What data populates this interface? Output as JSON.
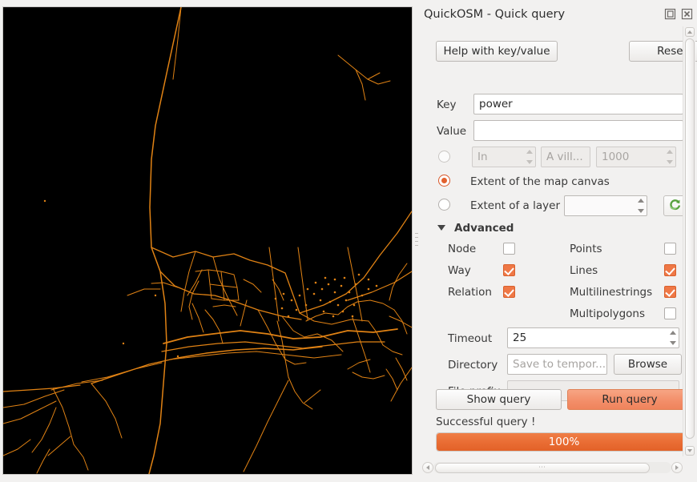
{
  "panel": {
    "title": "QuickOSM - Quick query",
    "title_buttons": [
      {
        "name": "float-icon",
        "tooltip": "Undock"
      },
      {
        "name": "close-icon",
        "tooltip": "Close"
      }
    ]
  },
  "toolbar": {
    "help_label": "Help with key/value",
    "reset_label": "Reset"
  },
  "query": {
    "key_label": "Key",
    "key_value": "power",
    "value_label": "Value",
    "value_value": "",
    "value_placeholder": ""
  },
  "extent": {
    "around_selected": false,
    "around_in_label": "In",
    "around_place_placeholder": "A vill...",
    "around_distance": "1000",
    "map_canvas_selected": true,
    "map_canvas_label": "Extent of the map canvas",
    "layer_selected": false,
    "layer_label": "Extent of a layer",
    "layer_value": "",
    "refresh_icon": "refresh-icon"
  },
  "advanced": {
    "header_label": "Advanced",
    "expanded": true,
    "osm_objects": [
      {
        "label": "Node",
        "checked": false
      },
      {
        "label": "Way",
        "checked": true
      },
      {
        "label": "Relation",
        "checked": true
      }
    ],
    "geometries": [
      {
        "label": "Points",
        "checked": false
      },
      {
        "label": "Lines",
        "checked": true
      },
      {
        "label": "Multilinestrings",
        "checked": true
      },
      {
        "label": "Multipolygons",
        "checked": false
      }
    ],
    "timeout_label": "Timeout",
    "timeout_value": "25",
    "directory_label": "Directory",
    "directory_placeholder": "Save to tempor...",
    "directory_value": "",
    "browse_label": "Browse",
    "file_prefix_label": "File prefix",
    "file_prefix_value": ""
  },
  "actions": {
    "show_query_label": "Show query",
    "run_query_label": "Run query"
  },
  "status": {
    "message": "Successful query !",
    "progress_percent": 100,
    "progress_label": "100%"
  },
  "colors": {
    "accent_orange": "#ef7846",
    "run_button": "#f3916a",
    "progress_fill": "#e8703a",
    "panel_bg": "#f2f1f0",
    "map_bg": "#000000",
    "map_line": "#e08214"
  },
  "map": {
    "background": "#000000",
    "line_color": "#e08214",
    "layer_description": "OSM power lines rendered as orange linework on black canvas"
  }
}
